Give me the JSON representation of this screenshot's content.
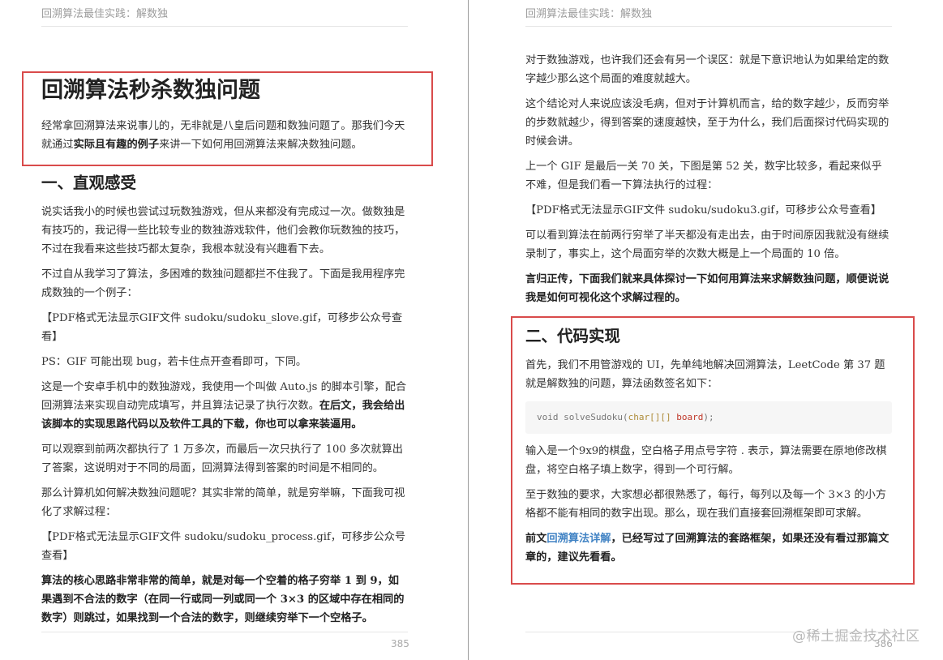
{
  "running_head": "回溯算法最佳实践：解数独",
  "left_page": {
    "title": "回溯算法秒杀数独问题",
    "intro_before": "经常拿回溯算法来说事儿的，无非就是八皇后问题和数独问题了。那我们今天就通过",
    "intro_bold": "实际且有趣的例子",
    "intro_after": "来讲一下如何用回溯算法来解决数独问题。",
    "section1_heading": "一、直观感受",
    "p1": "说实话我小的时候也尝试过玩数独游戏，但从来都没有完成过一次。做数独是有技巧的，我记得一些比较专业的数独游戏软件，他们会教你玩数独的技巧，不过在我看来这些技巧都太复杂，我根本就没有兴趣看下去。",
    "p2": "不过自从我学习了算法，多困难的数独问题都拦不住我了。下面是我用程序完成数独的一个例子：",
    "gif1": "【PDF格式无法显示GIF文件 sudoku/sudoku_slove.gif，可移步公众号查看】",
    "p3": "PS：GIF 可能出现 bug，若卡住点开查看即可，下同。",
    "p4_before": "这是一个安卓手机中的数独游戏，我使用一个叫做 Auto.js 的脚本引擎，配合回溯算法来实现自动完成填写，并且算法记录了执行次数。",
    "p4_bold": "在后文，我会给出该脚本的实现思路代码以及软件工具的下载，你也可以拿来装逼用。",
    "p5": "可以观察到前两次都执行了 1 万多次，而最后一次只执行了 100 多次就算出了答案，这说明对于不同的局面，回溯算法得到答案的时间是不相同的。",
    "p6": "那么计算机如何解决数独问题呢？其实非常的简单，就是穷举嘛，下面我可视化了求解过程：",
    "gif2": "【PDF格式无法显示GIF文件 sudoku/sudoku_process.gif，可移步公众号查看】",
    "p7_bold": "算法的核心思路非常非常的简单，就是对每一个空着的格子穷举 1 到 9，如果遇到不合法的数字（在同一行或同一列或同一个 3×3 的区域中存在相同的数字）则跳过，如果找到一个合法的数字，则继续穷举下一个空格子。",
    "page_number": "385"
  },
  "right_page": {
    "p1": "对于数独游戏，也许我们还会有另一个误区：就是下意识地认为如果给定的数字越少那么这个局面的难度就越大。",
    "p2": "这个结论对人来说应该没毛病，但对于计算机而言，给的数字越少，反而穷举的步数就越少，得到答案的速度越快，至于为什么，我们后面探讨代码实现的时候会讲。",
    "p3": "上一个 GIF 是最后一关 70 关，下图是第 52 关，数字比较多，看起来似乎不难，但是我们看一下算法执行的过程：",
    "gif3": "【PDF格式无法显示GIF文件 sudoku/sudoku3.gif，可移步公众号查看】",
    "p4": "可以看到算法在前两行穷举了半天都没有走出去，由于时间原因我就没有继续录制了，事实上，这个局面穷举的次数大概是上一个局面的 10 倍。",
    "p5_bold": "言归正传，下面我们就来具体探讨一下如何用算法来求解数独问题，顺便说说我是如何可视化这个求解过程的。",
    "section2_heading": "二、代码实现",
    "p6": "首先，我们不用管游戏的 UI，先单纯地解决回溯算法，LeetCode 第 37 题就是解数独的问题，算法函数签名如下：",
    "code_void": "void solveSudoku(",
    "code_type": "char[][]",
    "code_param": " board",
    "code_end": ");",
    "p7": "输入是一个9x9的棋盘，空白格子用点号字符  .  表示，算法需要在原地修改棋盘，将空白格子填上数字，得到一个可行解。",
    "p8": "至于数独的要求，大家想必都很熟悉了，每行，每列以及每一个 3×3 的小方格都不能有相同的数字出现。那么，现在我们直接套回溯框架即可求解。",
    "p9_before": "前文",
    "p9_link": "回溯算法详解",
    "p9_after": "，已经写过了回溯算法的套路框架，如果还没有看过那篇文章的，建议先看看。",
    "page_number": "386"
  },
  "watermark": "@稀土掘金技术社区",
  "colors": {
    "highlight": "#d94b4b",
    "link": "#4183c4",
    "code_bg": "#f6f6f6"
  }
}
